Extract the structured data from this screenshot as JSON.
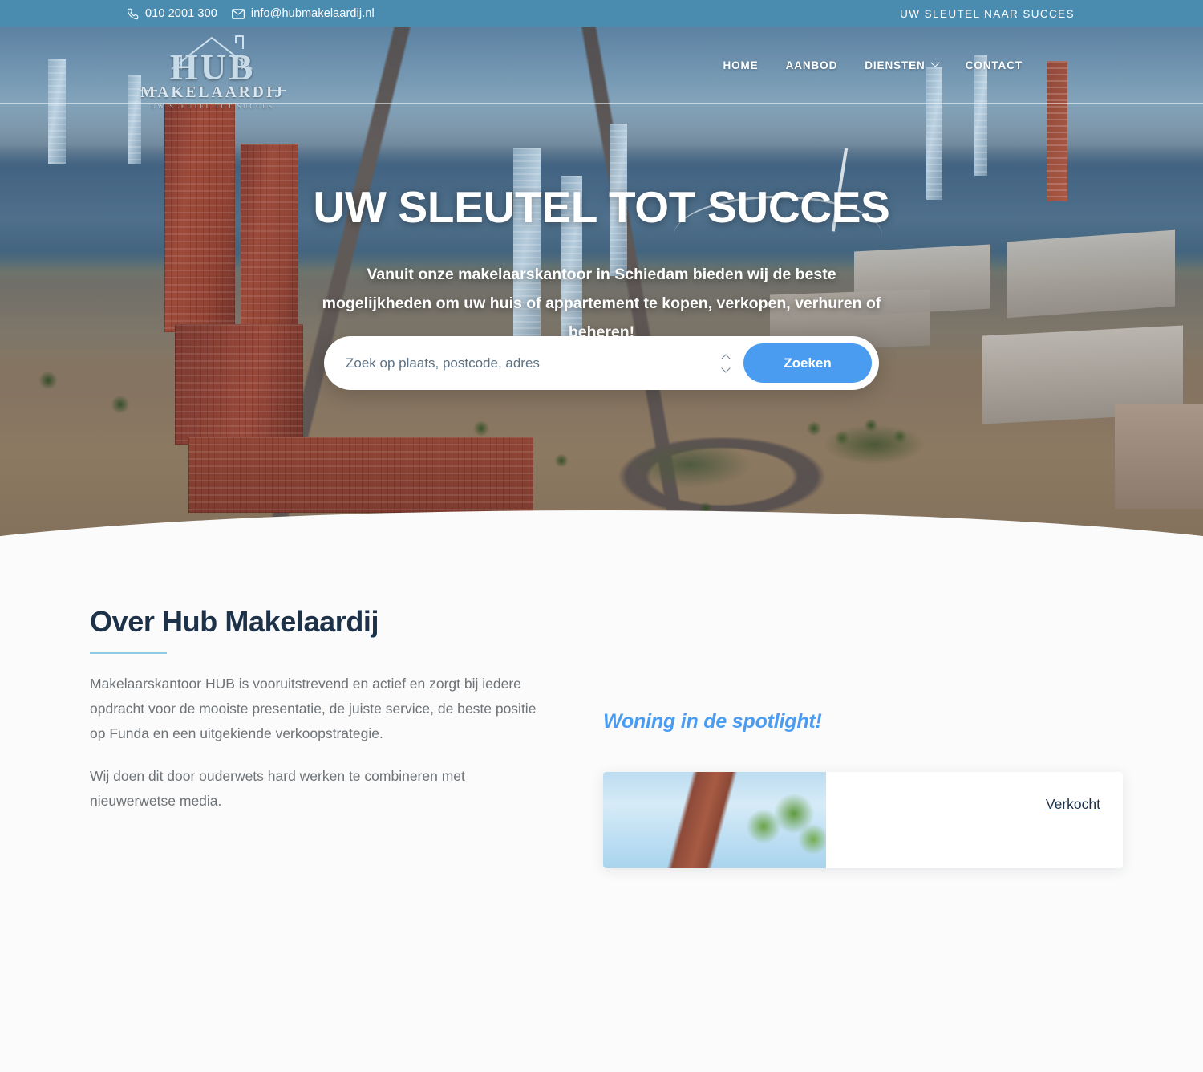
{
  "topbar": {
    "phone": "010 2001 300",
    "email": "info@hubmakelaardij.nl",
    "tagline": "UW SLEUTEL NAAR SUCCES",
    "phone_icon": "phone-icon",
    "email_icon": "envelope-icon"
  },
  "logo": {
    "name": "HUB",
    "subtitle": "MAKELAARDIJ",
    "tagline": "UW SLEUTEL TOT SUCCES"
  },
  "nav": {
    "items": [
      {
        "label": "HOME",
        "has_dropdown": false
      },
      {
        "label": "AANBOD",
        "has_dropdown": false
      },
      {
        "label": "DIENSTEN",
        "has_dropdown": true
      },
      {
        "label": "CONTACT",
        "has_dropdown": false
      }
    ],
    "account_icon": "user-circle-icon"
  },
  "hero": {
    "title": "UW SLEUTEL TOT SUCCES",
    "subtitle": "Vanuit onze makelaarskantoor in Schiedam bieden wij de beste mogelijkheden om uw huis of appartement te kopen, verkopen, verhuren of beheren!",
    "search": {
      "placeholder": "Zoek op plaats, postcode, adres",
      "value": "",
      "selector_icon": "up-down-chevron-icon",
      "button_label": "Zoeken"
    }
  },
  "about": {
    "heading": "Over Hub Makelaardij",
    "paragraph_1": "Makelaarskantoor HUB is vooruitstrevend en actief en zorgt bij iedere opdracht voor de mooiste presentatie, de juiste service, de beste positie op Funda en een uitgekiende verkoopstrategie.",
    "paragraph_2": "Wij doen dit door ouderwets hard werken te combineren met nieuwerwetse media."
  },
  "spotlight": {
    "heading": "Woning in de spotlight!",
    "property": {
      "status": "Verkocht",
      "image_alt": "property-photo"
    }
  },
  "colors": {
    "topbar_blue": "#4a8cb0",
    "accent_blue": "#4a9cf0",
    "heading_navy": "#1d3148",
    "rule_light_blue": "#8fcbe4",
    "body_gray": "#6e7377",
    "section_bg": "#fbfbfb"
  }
}
